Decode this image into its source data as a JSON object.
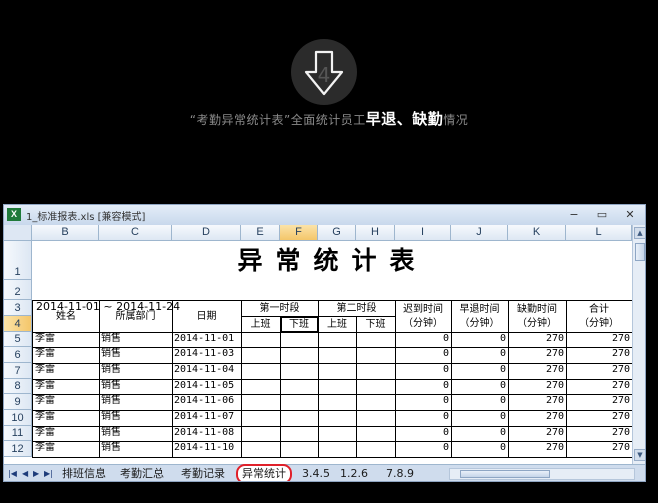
{
  "banner": {
    "caption_prefix": "“考勤异常统计表”全面统计员工",
    "caption_emphasis": "早退、缺勤",
    "caption_suffix": "情况"
  },
  "window": {
    "title": "1_标准报表.xls  [兼容模式]",
    "minimize": "−",
    "restore": "▭",
    "close": "✕"
  },
  "sheet": {
    "columns": [
      "B",
      "C",
      "D",
      "E",
      "F",
      "G",
      "H",
      "I",
      "J",
      "K",
      "L"
    ],
    "selected_column": "F",
    "row_numbers": [
      "1",
      "2",
      "3",
      "4",
      "5",
      "6",
      "7",
      "8",
      "9",
      "10",
      "11",
      "12"
    ],
    "selected_row": "4",
    "title": "异常统计表",
    "date_range": "2014-11-01 ~ 2014-11-24",
    "headers": {
      "name": "姓名",
      "department": "所属部门",
      "date": "日期",
      "shift1": "第一时段",
      "shift2": "第二时段",
      "on_duty": "上班",
      "off_duty": "下班",
      "late": "迟到时间",
      "early": "早退时间",
      "absent": "缺勤时间",
      "total": "合计",
      "unit": "（分钟）"
    },
    "rows": [
      {
        "name": "李雷",
        "dept": "销售",
        "date": "2014-11-01",
        "late": "0",
        "early": "0",
        "absent": "270",
        "total": "270"
      },
      {
        "name": "李雷",
        "dept": "销售",
        "date": "2014-11-03",
        "late": "0",
        "early": "0",
        "absent": "270",
        "total": "270"
      },
      {
        "name": "李雷",
        "dept": "销售",
        "date": "2014-11-04",
        "late": "0",
        "early": "0",
        "absent": "270",
        "total": "270"
      },
      {
        "name": "李雷",
        "dept": "销售",
        "date": "2014-11-05",
        "late": "0",
        "early": "0",
        "absent": "270",
        "total": "270"
      },
      {
        "name": "李雷",
        "dept": "销售",
        "date": "2014-11-06",
        "late": "0",
        "early": "0",
        "absent": "270",
        "total": "270"
      },
      {
        "name": "李雷",
        "dept": "销售",
        "date": "2014-11-07",
        "late": "0",
        "early": "0",
        "absent": "270",
        "total": "270"
      },
      {
        "name": "李雷",
        "dept": "销售",
        "date": "2014-11-08",
        "late": "0",
        "early": "0",
        "absent": "270",
        "total": "270"
      },
      {
        "name": "李雷",
        "dept": "销售",
        "date": "2014-11-10",
        "late": "0",
        "early": "0",
        "absent": "270",
        "total": "270"
      }
    ]
  },
  "tabs": [
    "排班信息",
    "考勤汇总",
    "考勤记录",
    "异常统计",
    "3.4.5",
    "1.2.6",
    "7.8.9"
  ],
  "active_tab": "异常统计",
  "colors": {
    "highlight": "#e0202a",
    "header_selected": "#f4c66a"
  }
}
